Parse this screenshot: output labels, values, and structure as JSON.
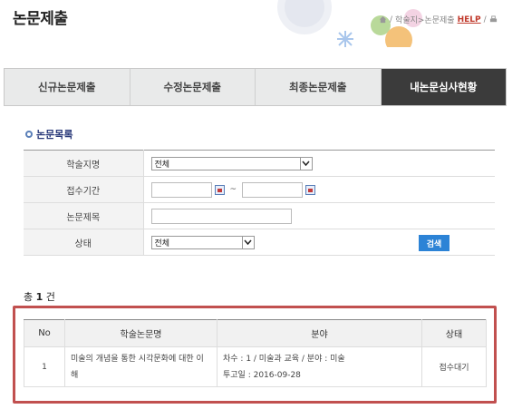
{
  "header": {
    "title": "논문제출",
    "breadcrumb_path": "학술지>논문제출",
    "help_label": "HELP"
  },
  "tabs": [
    {
      "label": "신규논문제출",
      "active": false
    },
    {
      "label": "수정논문제출",
      "active": false
    },
    {
      "label": "최종논문제출",
      "active": false
    },
    {
      "label": "내논문심사현황",
      "active": true
    }
  ],
  "section_title": "논문목록",
  "search_form": {
    "journal": {
      "label": "학술지명",
      "value": "전체"
    },
    "period": {
      "label": "접수기간",
      "from": "",
      "to": "",
      "separator": "~"
    },
    "paper_title": {
      "label": "논문제목",
      "value": ""
    },
    "status": {
      "label": "상태",
      "value": "전체"
    },
    "search_label": "검색"
  },
  "result_count": {
    "prefix": "총",
    "count": "1",
    "suffix": "건"
  },
  "results": {
    "columns": [
      "No",
      "학술논문명",
      "분야",
      "상태"
    ],
    "rows": [
      {
        "no": "1",
        "title": "미술의 개념을 통한 시각문화에 대한 이해",
        "field": "차수 : 1 / 미술과 교육 / 분야 : 미술",
        "submitted": "투고일 : 2016-09-28",
        "status": "접수대기"
      }
    ]
  },
  "colors": {
    "active_tab": "#3b3b3b",
    "search_button": "#2c83d6",
    "highlight": "#c1504f",
    "section_title": "#2a3a7a"
  }
}
